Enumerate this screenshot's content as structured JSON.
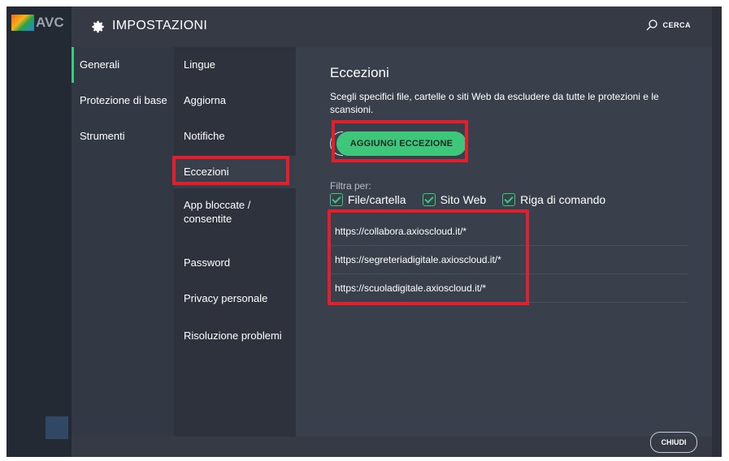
{
  "background": {
    "logo_text": "AVC"
  },
  "header": {
    "title": "IMPOSTAZIONI",
    "search_label": "CERCA"
  },
  "nav_primary": [
    {
      "label": "Generali",
      "active": true
    },
    {
      "label": "Protezione di base"
    },
    {
      "label": "Strumenti"
    }
  ],
  "nav_secondary": [
    {
      "label": "Lingue"
    },
    {
      "label": "Aggiorna"
    },
    {
      "label": "Notifiche"
    },
    {
      "label": "Eccezioni",
      "selected": true
    },
    {
      "label": "App bloccate / consentite"
    },
    {
      "label": "Password"
    },
    {
      "label": "Privacy personale"
    },
    {
      "label": "Risoluzione problemi"
    }
  ],
  "content": {
    "title": "Eccezioni",
    "description": "Scegli specifici file, cartelle o siti Web da escludere da tutte le protezioni e le scansioni.",
    "add_button": "AGGIUNGI ECCEZIONE",
    "filter_label": "Filtra per:",
    "filters": [
      {
        "label": "File/cartella",
        "checked": true
      },
      {
        "label": "Sito Web",
        "checked": true
      },
      {
        "label": "Riga di comando",
        "checked": true
      }
    ],
    "exceptions": [
      "https://collabora.axioscloud.it/*",
      "https://segreteriadigitale.axioscloud.it/*",
      "https://scuoladigitale.axioscloud.it/*"
    ]
  },
  "footer": {
    "close_label": "CHIUDI"
  },
  "colors": {
    "accent": "#3ec67a",
    "highlight": "#e21f2c",
    "panel": "#3a404b"
  }
}
